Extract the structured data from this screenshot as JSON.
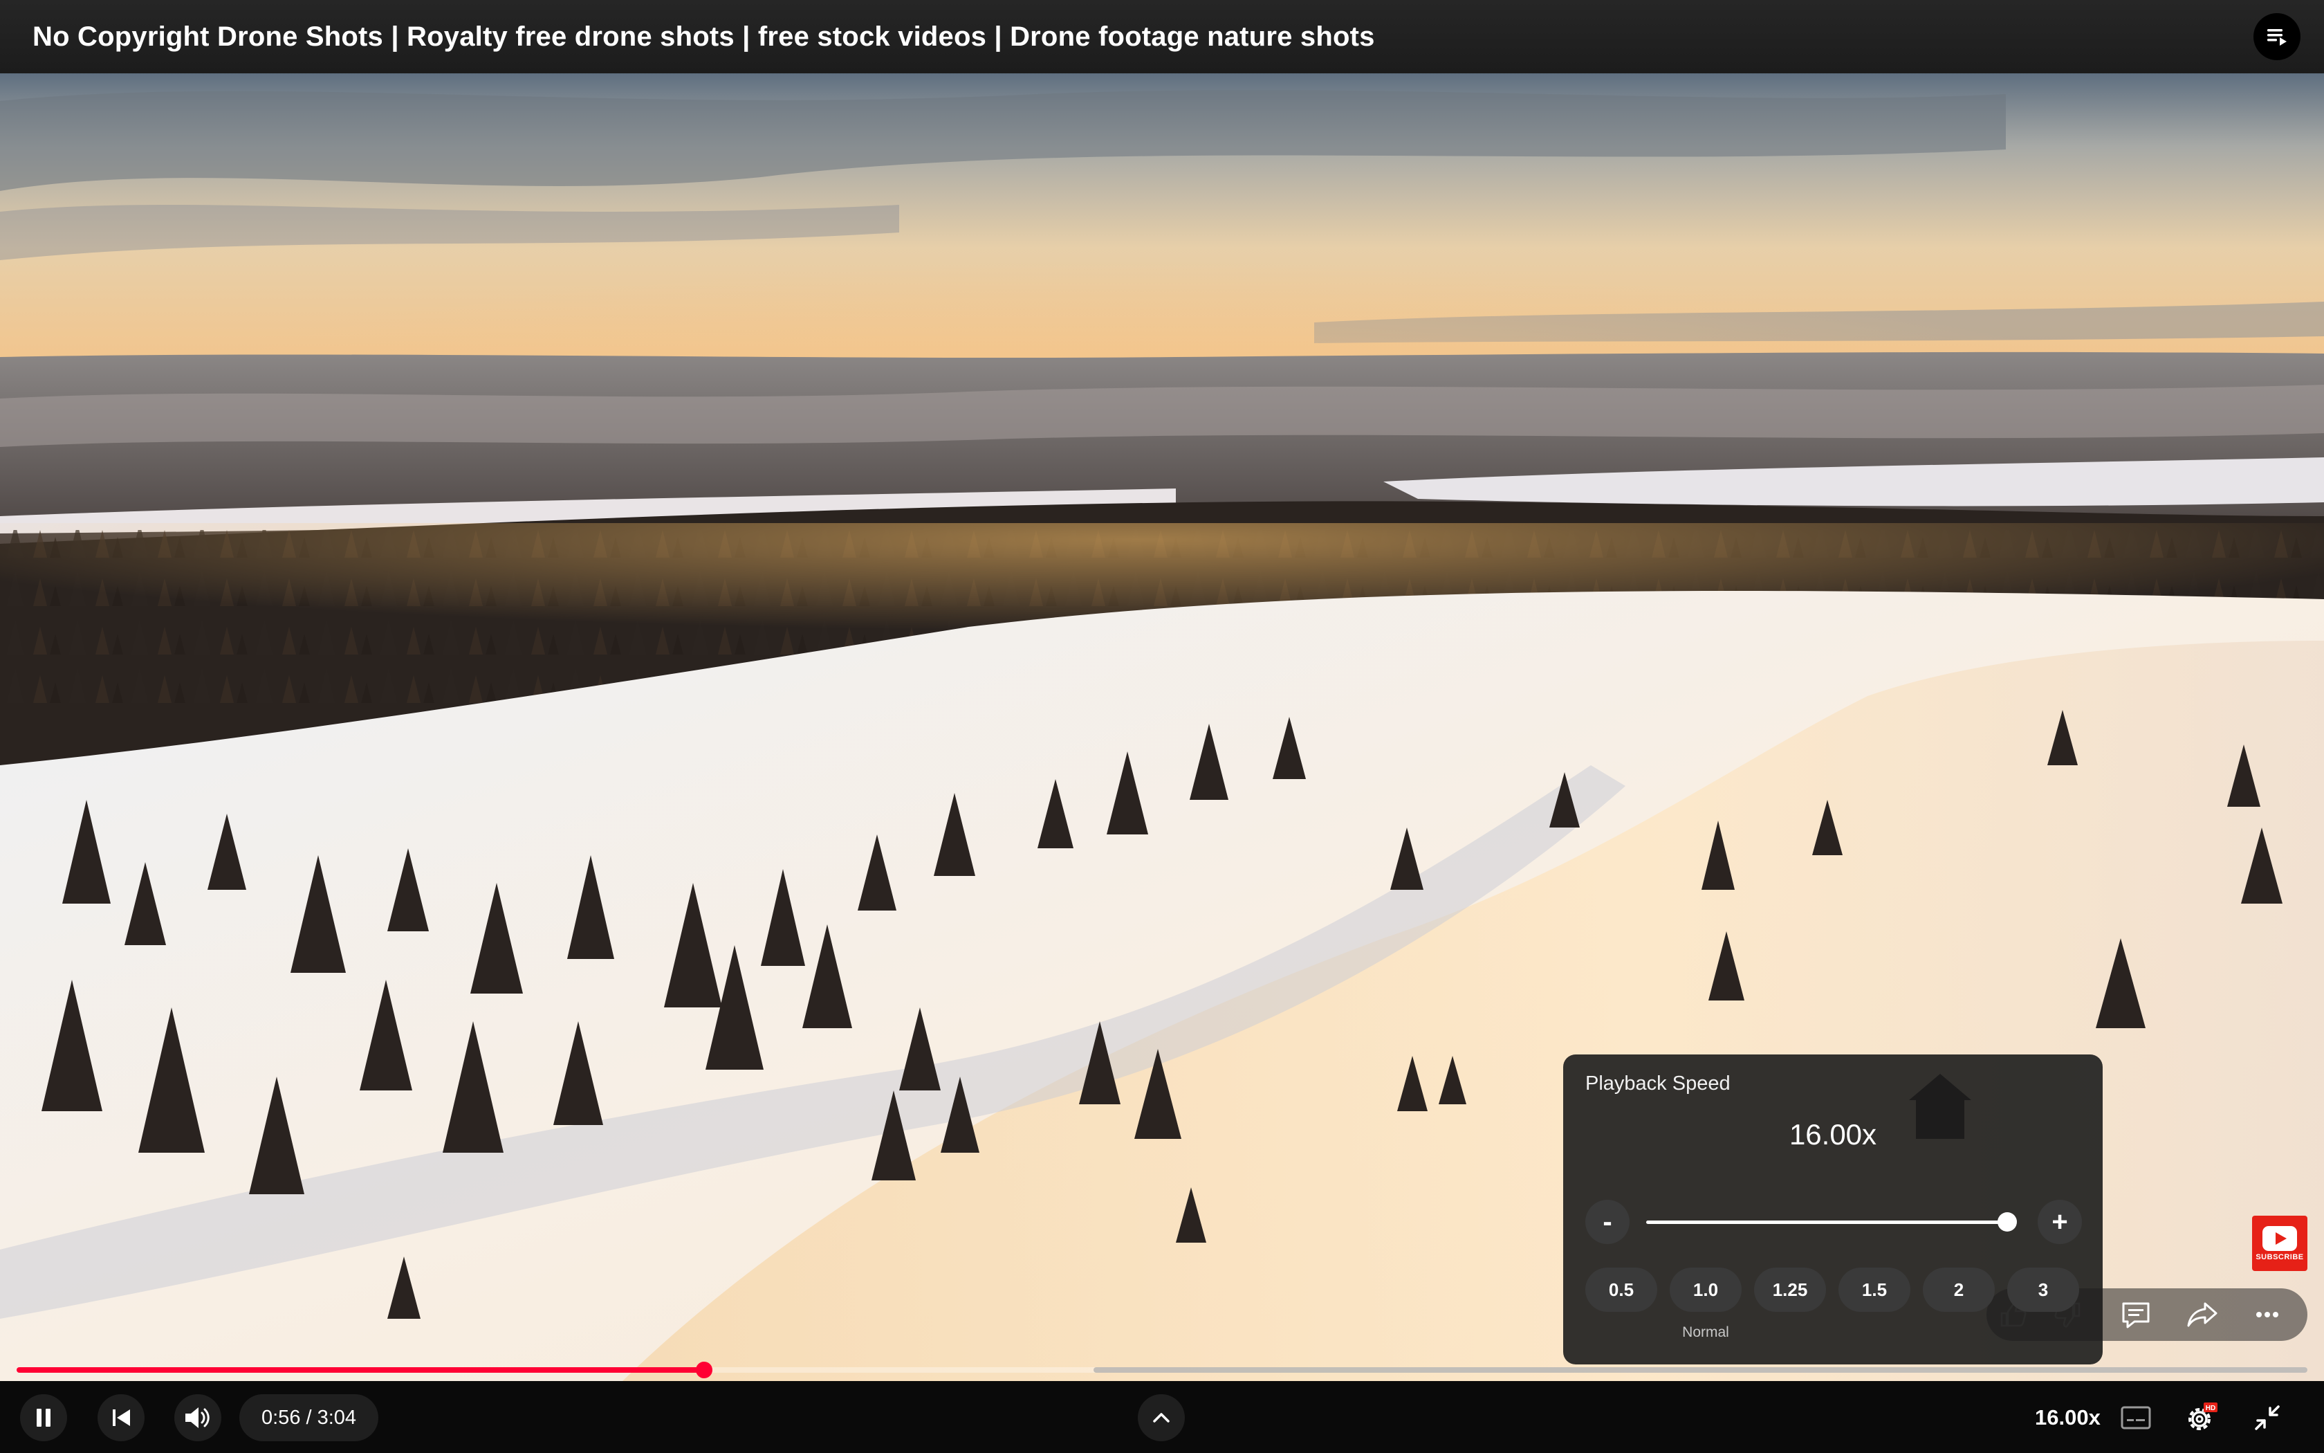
{
  "header": {
    "title": "No Copyright Drone Shots | Royalty free drone shots | free stock videos | Drone footage nature shots",
    "queue_icon": "playlist-icon"
  },
  "video": {
    "scene": "snowy-forest-sunset-aerial",
    "progress_fraction": 0.3,
    "buffered_from_fraction": 0.47
  },
  "speed_panel": {
    "title": "Playback Speed",
    "value": "16.00x",
    "minus_label": "-",
    "plus_label": "+",
    "slider_fraction": 1.0,
    "presets": [
      "0.5",
      "1.0",
      "1.25",
      "1.5",
      "2",
      "3"
    ],
    "normal_note": "Normal"
  },
  "overlay_actions": {
    "icons": [
      "like-icon",
      "dislike-icon",
      "comment-icon",
      "share-icon",
      "more-icon"
    ],
    "subscribe_label": "SUBSCRIBE"
  },
  "controls": {
    "time_display": "0:56 / 3:04",
    "speed_label": "16.00x",
    "hd_badge": "HD",
    "icons": [
      "pause-icon",
      "previous-icon",
      "volume-icon",
      "chevron-up-icon",
      "captions-icon",
      "settings-icon",
      "exit-fullscreen-icon"
    ]
  },
  "colors": {
    "accent": "#ff0033",
    "panel_bg": "#1c1c1c",
    "subscribe": "#e62117"
  }
}
